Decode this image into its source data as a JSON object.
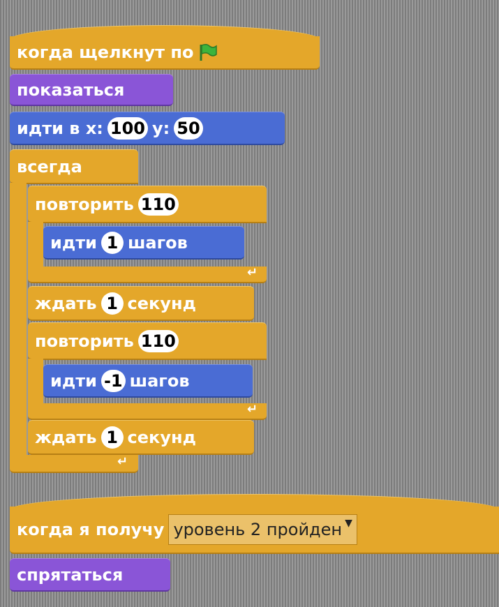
{
  "script1": {
    "hat_label": "когда щелкнут по",
    "hat_icon": "green-flag-icon",
    "show_label": "показаться",
    "goto_label": "идти в x:",
    "goto_x": "100",
    "goto_y_label": "y:",
    "goto_y": "50",
    "forever_label": "всегда",
    "repeat1_label": "повторить",
    "repeat1_count": "110",
    "move1_label": "идти",
    "move1_steps": "1",
    "move1_unit": "шагов",
    "wait1_label": "ждать",
    "wait1_value": "1",
    "wait1_unit": "секунд",
    "repeat2_label": "повторить",
    "repeat2_count": "110",
    "move2_label": "идти",
    "move2_steps": "-1",
    "move2_unit": "шагов",
    "wait2_label": "ждать",
    "wait2_value": "1",
    "wait2_unit": "секунд"
  },
  "script2": {
    "hat_label": "когда я получу",
    "message": "уровень 2 пройден",
    "hide_label": "спрятаться"
  },
  "colors": {
    "control": "#e4a72a",
    "looks": "#8a55d7",
    "motion": "#4a6cd4",
    "flag": "#3cb43c"
  }
}
